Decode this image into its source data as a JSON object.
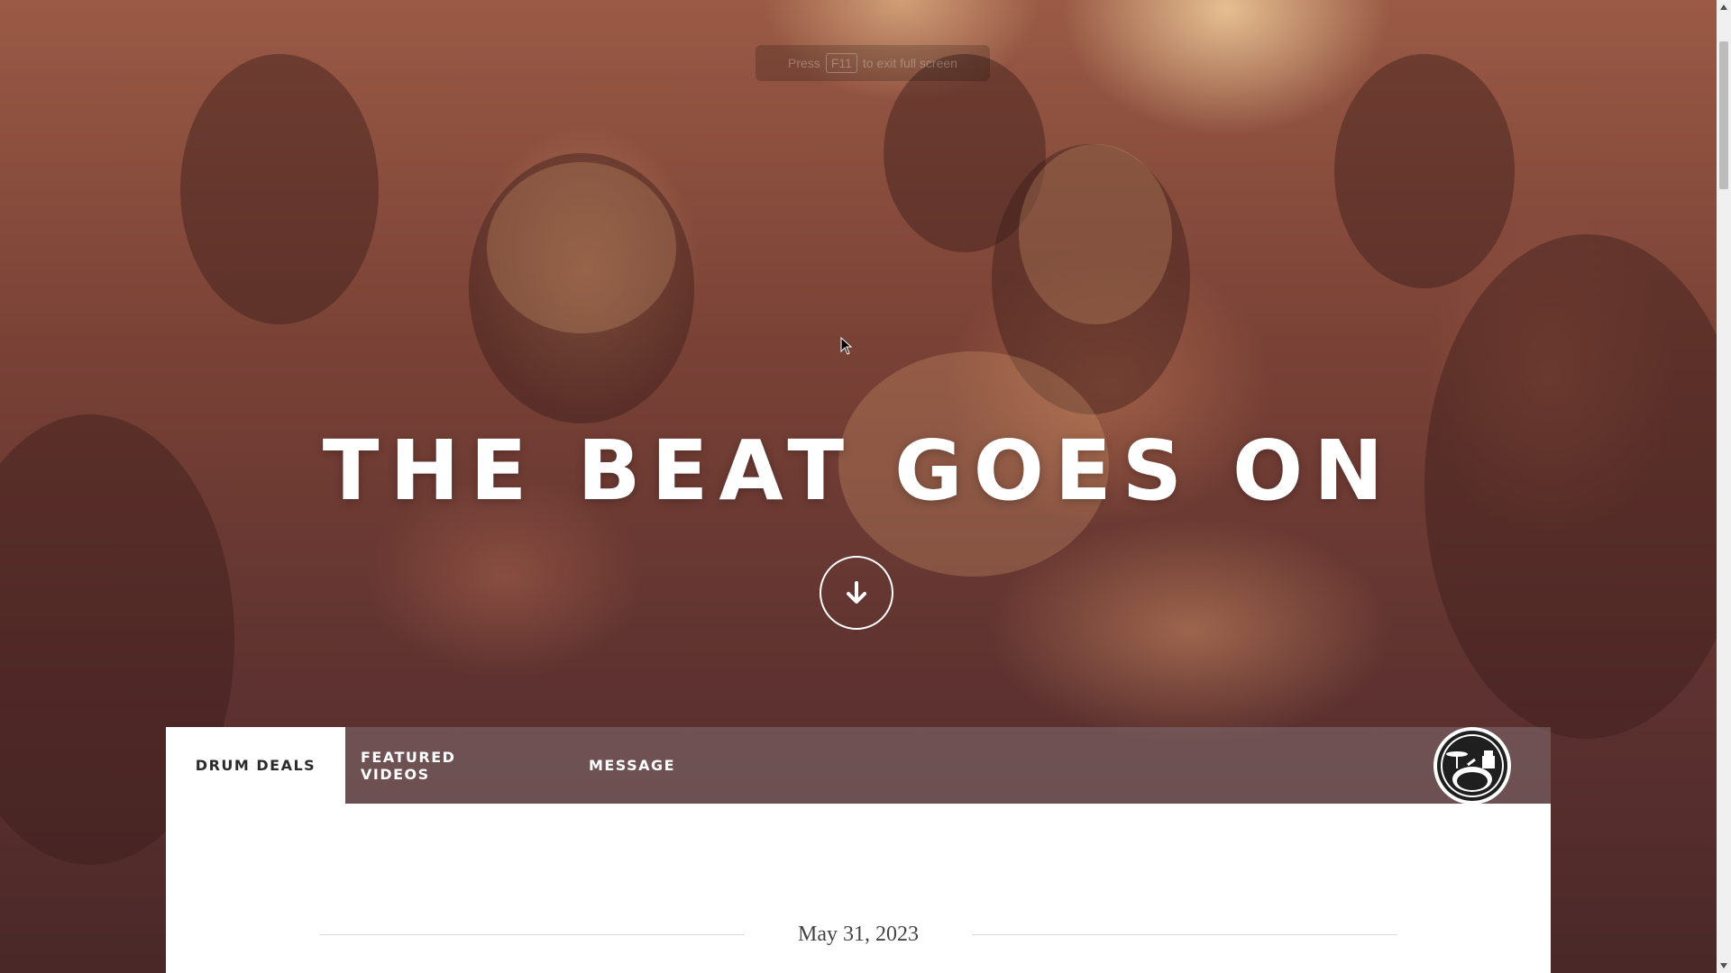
{
  "fullscreen_hint": {
    "prefix": "Press",
    "key": "F11",
    "suffix": "to exit full screen"
  },
  "hero": {
    "title": "THE BEAT GOES ON",
    "scroll_button_icon": "arrow-down-icon"
  },
  "tabs": [
    {
      "label": "DRUM DEALS",
      "active": true
    },
    {
      "label": "FEATURED VIDEOS",
      "active": false
    },
    {
      "label": "MESSAGE",
      "active": false
    }
  ],
  "logo": {
    "icon": "drum-kit-icon"
  },
  "content": {
    "date": "May 31, 2023"
  },
  "colors": {
    "tab_active_bg": "#ffffff",
    "tab_bar_bg": "#826e73",
    "hero_text": "#ffffff"
  }
}
